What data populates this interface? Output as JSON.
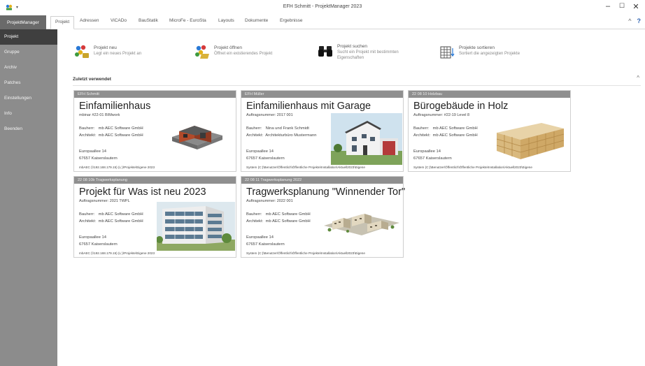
{
  "window": {
    "title": "EFH Schmitt - ProjektManager 2023",
    "controls": [
      "–",
      "☐",
      "✕"
    ]
  },
  "ribbon": {
    "app_tab": "ProjektManager",
    "tabs": [
      "Projekt",
      "Adressen",
      "ViCADo",
      "BauStatik",
      "MicroFe - EuroSta",
      "Layouts",
      "Dokumente",
      "Ergebnisse"
    ],
    "right": [
      "^",
      "?"
    ]
  },
  "sidebar": {
    "items": [
      "Projekt",
      "Gruppe",
      "Archiv",
      "Patches",
      "Einstellungen",
      "Info",
      "Beenden"
    ]
  },
  "actions": [
    {
      "title": "Projekt neu",
      "desc": "Legt ein neues Projekt an"
    },
    {
      "title": "Projekt öffnen",
      "desc": "Öffnet ein existierendes Projekt"
    },
    {
      "title": "Projekt suchen",
      "desc": "Sucht ein Projekt mit bestimmten Eigenschaften"
    },
    {
      "title": "Projekte sortieren",
      "desc": "Sortiert die angezeigten Projekte"
    }
  ],
  "recent": {
    "heading": "Zuletzt verwendet",
    "collapse": "^"
  },
  "labels": {
    "bauherr": "Bauherr:",
    "architekt": "Architekt:"
  },
  "projects": [
    {
      "header": "EFH Schmitt",
      "name": "Einfamilienhaus",
      "number": "mbinar #22-01 BIMwork",
      "bauherr": "mb AEC Software GmbH",
      "architekt": "mb AEC Software GmbH",
      "street": "Europaallee 14",
      "city": "67657 Kaiserslautern",
      "path": "mbAEC (\\\\192.168.179.15) (L:)\\Projekte\\Eigene 2023"
    },
    {
      "header": "EFH Müller",
      "name": "Einfamilienhaus mit Garage",
      "number": "Auftragsnummer: 2017 001",
      "bauherr": "Nina und Frank Schmidt",
      "architekt": "Architekturbüro Mustermann",
      "street": "Europaallee 14",
      "city": "67657 Kaiserslautern",
      "path": "System (C:)\\Benutzer\\Öffentlich\\Öffentliche Projekte\\Installation\\Aktuell2023\\Eigene"
    },
    {
      "header": "22 08 10 Holzbau",
      "name": "Bürogebäude in Holz",
      "number": "Auftragsnummer: #22-19 Level 8",
      "bauherr": "mb AEC Software GmbH",
      "architekt": "mb AEC Software GmbH",
      "street": "Europaallee 14",
      "city": "67657 Kaiserslautern",
      "path": "System (C:)\\Benutzer\\Öffentlich\\Öffentliche Projekte\\Installation\\Aktuell2023\\Eigene"
    },
    {
      "header": "22 08 10b Tragwerksplanung",
      "name": "Projekt für Was ist neu 2023",
      "number": "Auftragsnummer: 2021 TWPL",
      "bauherr": "mb AEC Software GmbH",
      "architekt": "mb AEC Software GmbH",
      "street": "Europaallee 14",
      "city": "67657 Kaiserslautern",
      "path": "mbAEC (\\\\192.168.179.15) (L:)\\Projekte\\Eigene 2023"
    },
    {
      "header": "22 08 11 Tragwerksplanung 2022",
      "name": "Tragwerksplanung \"Winnender Tor\"",
      "number": "Auftragsnummer: 2022 001",
      "bauherr": "mb AEC Software GmbH",
      "architekt": "mb AEC Software GmbH",
      "street": "Europaallee 14",
      "city": "67657 Kaiserslautern",
      "path": "System (C:)\\Benutzer\\Öffentlich\\Öffentliche Projekte\\Installation\\Aktuell2023\\Eigene"
    }
  ]
}
